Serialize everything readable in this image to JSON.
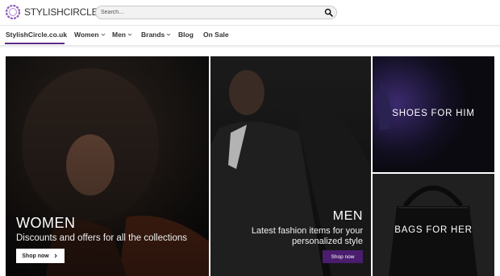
{
  "brand": {
    "logo_text": "STYLISHCIRCLE",
    "accent_color": "#5b2a86"
  },
  "search": {
    "placeholder": "Search...",
    "icon": "search-icon"
  },
  "nav": {
    "items": [
      {
        "label": "StylishCircle.co.uk",
        "active": true,
        "dropdown": false
      },
      {
        "label": "Women",
        "dropdown": true
      },
      {
        "label": "Men",
        "dropdown": true
      },
      {
        "label": "Brands",
        "dropdown": true
      },
      {
        "label": "Blog",
        "dropdown": false
      },
      {
        "label": "On Sale",
        "dropdown": false
      }
    ]
  },
  "tiles": {
    "women": {
      "title": "WOMEN",
      "subtitle": "Discounts and offers for all the collections",
      "button": "Shop now",
      "button_icon": "chevron-right-icon"
    },
    "men": {
      "title": "MEN",
      "subtitle": "Latest fashion items for your personalized style",
      "button": "Shop now",
      "button_color": "#4a1d6e"
    },
    "shoes": {
      "title": "SHOES FOR HIM"
    },
    "bags": {
      "title": "BAGS FOR HER"
    }
  }
}
